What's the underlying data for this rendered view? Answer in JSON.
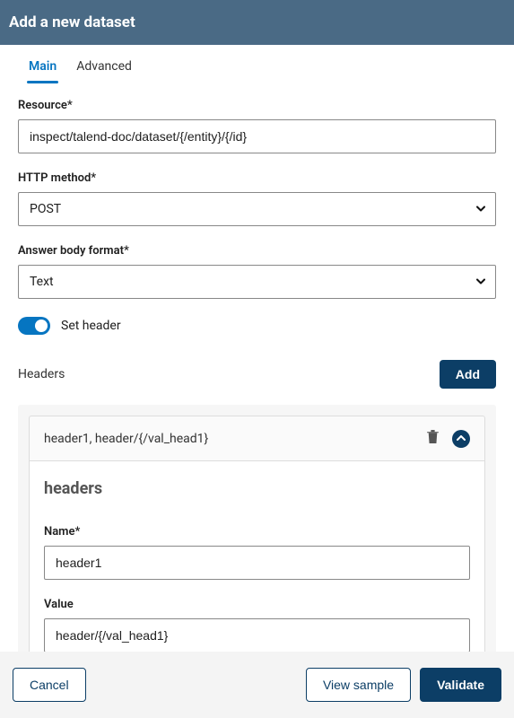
{
  "header": {
    "title": "Add a new dataset"
  },
  "tabs": {
    "main": "Main",
    "advanced": "Advanced",
    "active": "main"
  },
  "fields": {
    "resource": {
      "label": "Resource*",
      "value": "inspect/talend-doc/dataset/{/entity}/{/id}"
    },
    "http_method": {
      "label": "HTTP method*",
      "value": "POST"
    },
    "answer_body": {
      "label": "Answer body format*",
      "value": "Text"
    },
    "set_header": {
      "label": "Set header"
    }
  },
  "headers_section": {
    "label": "Headers",
    "add_label": "Add",
    "item": {
      "summary": "header1, header/{/val_head1}",
      "panel_title": "headers",
      "name_label": "Name*",
      "name_value": "header1",
      "value_label": "Value",
      "value_value": "header/{/val_head1}"
    }
  },
  "footer": {
    "cancel": "Cancel",
    "view_sample": "View sample",
    "validate": "Validate"
  }
}
